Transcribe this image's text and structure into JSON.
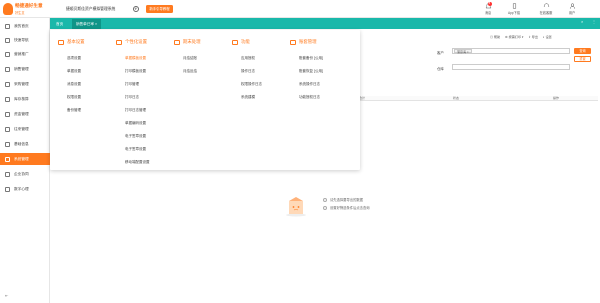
{
  "app": {
    "name": "畅捷通好生意",
    "sub": "好生意"
  },
  "company": {
    "name": "捷顺贝斯佳资产模拟管理系统",
    "help": "?"
  },
  "tutorial_button": "新手引导教程",
  "tools": [
    {
      "label": "消息",
      "badge": "8"
    },
    {
      "label": "App下载",
      "badge": ""
    },
    {
      "label": "在线客服",
      "badge": ""
    },
    {
      "label": "用户",
      "badge": ""
    }
  ],
  "sidebar": {
    "items": [
      "我的首页",
      "快速导航",
      "营销推广",
      "销售管理",
      "采购管理",
      "库存核算",
      "资金管理",
      "往来管理",
      "基础信息",
      "系统管理",
      "企业协同",
      "数字心理"
    ],
    "collapse": "⇤"
  },
  "tabs": {
    "home": "首页",
    "active": "销售单已审 ×",
    "right_close": "×",
    "right_menu": "⋮"
  },
  "filters": {
    "toolbar": [
      "◎ 帮助",
      "⚙ 按需打印 ▾",
      "⇪ 导出",
      "◐ 设置"
    ],
    "customer_label": "客户",
    "customer_tag": "蒲京海 ×",
    "warehouse_label": "仓库",
    "query_btn": "查询",
    "reset_btn": "重置",
    "columns": [
      "合计",
      "状态",
      "操作"
    ]
  },
  "empty": {
    "line1": "请先选择要导出的数据",
    "line2": "设置好筛选条件后点击查询"
  },
  "dropdown": {
    "columns": [
      {
        "title": "基本设置",
        "items": [
          "选项设置",
          "单据设置",
          "消息设置",
          "权限设置",
          "备份管理"
        ],
        "highlight": []
      },
      {
        "title": "个性化设置",
        "items": [
          "单据模板设置",
          "打印模板设置",
          "打印管理",
          "打印日志",
          "打印日志管理",
          "单据编码设置",
          "电子签章设置",
          "电子签章设置",
          "移动端配置设置"
        ],
        "highlight": [
          0
        ]
      },
      {
        "title": "期末处理",
        "items": [
          "月结结账",
          "月结反结"
        ],
        "highlight": []
      },
      {
        "title": "功能",
        "items": [
          "应用授权",
          "操作日志",
          "权限操作日志",
          "系统建模"
        ],
        "highlight": []
      },
      {
        "title": "账套管理",
        "items": [
          "账套备份 [公用]",
          "账套恢复 [公用]",
          "系统操作日志",
          "功能授权日志"
        ],
        "highlight": []
      }
    ]
  }
}
